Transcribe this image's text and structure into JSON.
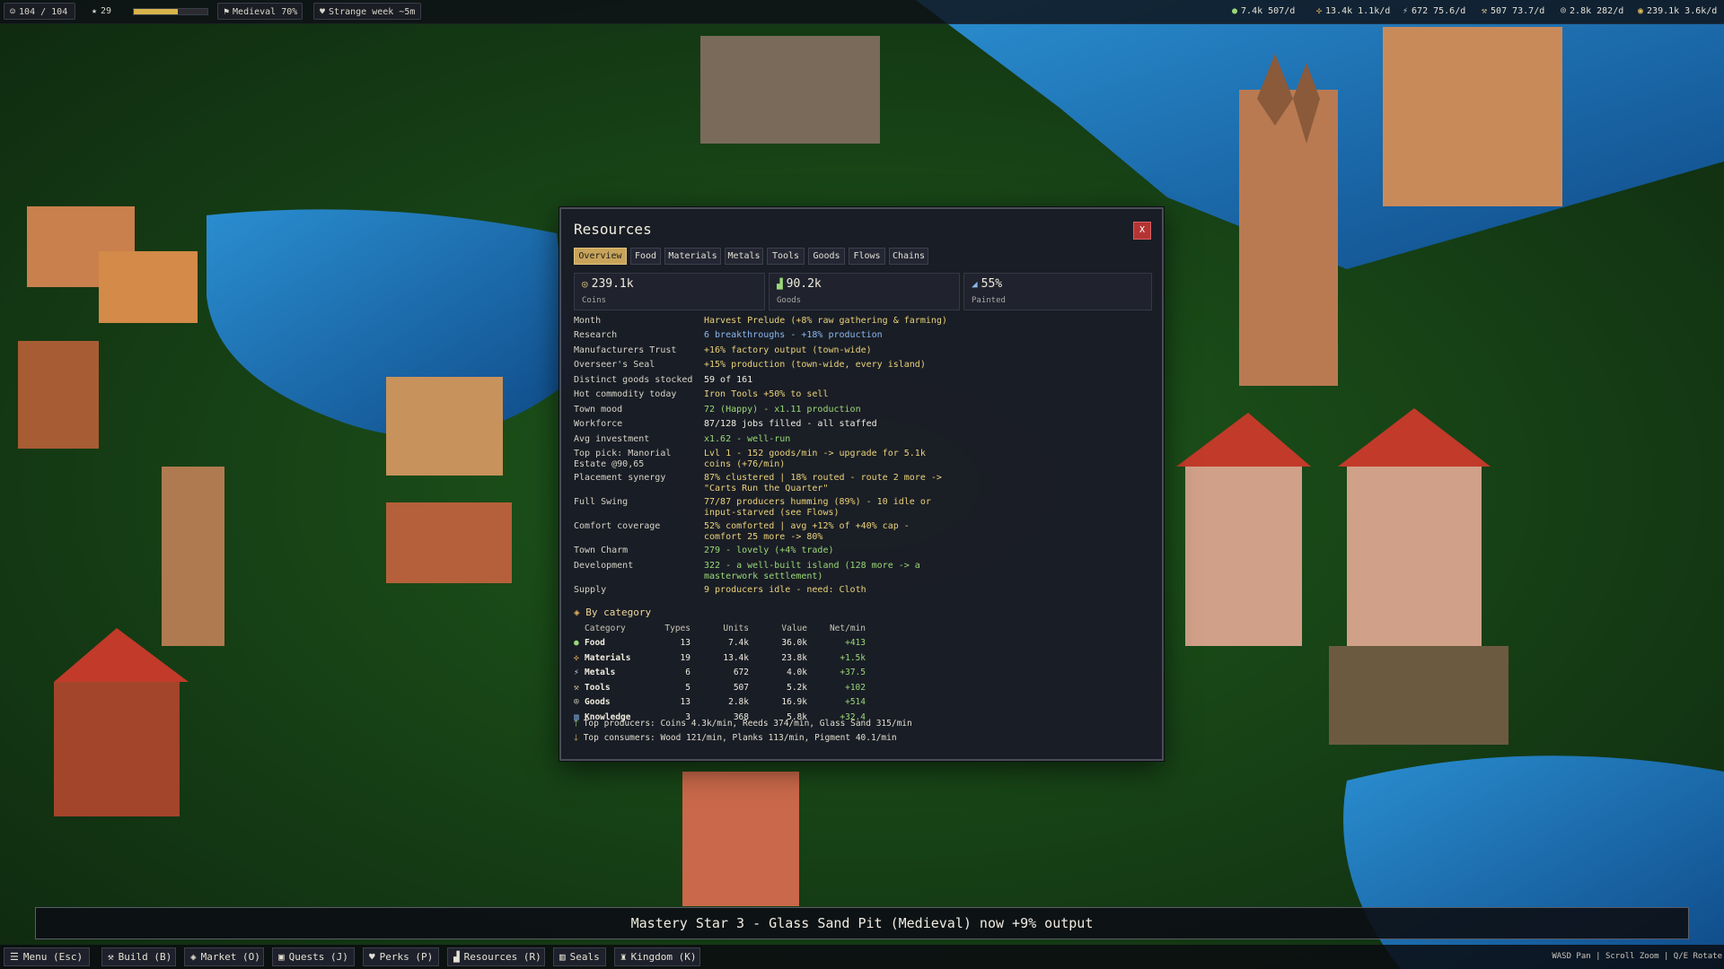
{
  "top_bar": {
    "population": "104 / 104",
    "stars": "29",
    "xp_fraction": 0.6,
    "era": "Medieval 70%",
    "event": "Strange week ~5m",
    "resources": [
      {
        "icon": "food-icon",
        "glyph": "●",
        "color": "#9ad878",
        "text": "7.4k 507/d"
      },
      {
        "icon": "materials-icon",
        "glyph": "✣",
        "color": "#e0b060",
        "text": "13.4k 1.1k/d"
      },
      {
        "icon": "metals-icon",
        "glyph": "⚡",
        "color": "#c8c8d8",
        "text": "672 75.6/d"
      },
      {
        "icon": "tools-icon",
        "glyph": "⚒",
        "color": "#d8c090",
        "text": "507 73.7/d"
      },
      {
        "icon": "goods-icon",
        "glyph": "⌾",
        "color": "#d8d0c0",
        "text": "2.8k 282/d"
      },
      {
        "icon": "coins-icon",
        "glyph": "◉",
        "color": "#e0c060",
        "text": "239.1k 3.6k/d"
      }
    ]
  },
  "window": {
    "title": "Resources",
    "close_label": "X",
    "tabs": [
      "Overview",
      "Food",
      "Materials",
      "Metals",
      "Tools",
      "Goods",
      "Flows",
      "Chains"
    ],
    "active_tab": "Overview",
    "stats": [
      {
        "icon": "coin-icon",
        "glyph": "◎",
        "value": "239.1k",
        "label": "Coins"
      },
      {
        "icon": "goods-chart-icon",
        "glyph": "▟",
        "value": "90.2k",
        "label": "Goods"
      },
      {
        "icon": "paint-icon",
        "glyph": "◢",
        "value": "55%",
        "label": "Painted"
      }
    ],
    "info_rows": [
      {
        "key": "Month",
        "value": "Harvest Prelude (+8% raw gathering & farming)",
        "color": "yellow"
      },
      {
        "key": "Research",
        "value": "6 breakthroughs - +18% production",
        "color": "blue"
      },
      {
        "key": "Manufacturers Trust",
        "value": "+16% factory output (town-wide)",
        "color": "yellow"
      },
      {
        "key": "Overseer's Seal",
        "value": "+15% production (town-wide, every island)",
        "color": "yellow"
      },
      {
        "key": "Distinct goods stocked",
        "value": "59 of 161",
        "color": "white"
      },
      {
        "key": "Hot commodity today",
        "value": "Iron Tools +50% to sell",
        "color": "yellow"
      },
      {
        "key": "Town mood",
        "value": "72 (Happy) - x1.11 production",
        "color": "green"
      },
      {
        "key": "Workforce",
        "value": "87/128 jobs filled - all staffed",
        "color": "white"
      },
      {
        "key": "Avg investment",
        "value": "x1.62 - well-run",
        "color": "green"
      },
      {
        "key": "Top pick: Manorial Estate @90,65",
        "value": "Lvl 1 - 152 goods/min -> upgrade for 5.1k coins (+76/min)",
        "color": "yellow"
      },
      {
        "key": "Placement synergy",
        "value": "87% clustered | 18% routed - route 2 more -> \"Carts Run the Quarter\"",
        "color": "yellow"
      },
      {
        "key": "Full Swing",
        "value": "77/87 producers humming (89%) - 10 idle or input-starved (see Flows)",
        "color": "yellow"
      },
      {
        "key": "Comfort coverage",
        "value": "52% comforted | avg +12% of +40% cap - comfort 25 more -> 80%",
        "color": "yellow"
      },
      {
        "key": "Town Charm",
        "value": "279 - lovely (+4% trade)",
        "color": "green"
      },
      {
        "key": "Development",
        "value": "322 - a well-built island (128 more -> a masterwork settlement)",
        "color": "green"
      },
      {
        "key": "Supply",
        "value": "9 producers idle - need: Cloth",
        "color": "yellow"
      }
    ],
    "by_category": {
      "title": "By category",
      "headers": {
        "category": "Category",
        "types": "Types",
        "units": "Units",
        "value": "Value",
        "net": "Net/min"
      },
      "rows": [
        {
          "icon": "food-icon",
          "glyph": "●",
          "color": "#9ad878",
          "name": "Food",
          "types": "13",
          "units": "7.4k",
          "value": "36.0k",
          "net": "+413"
        },
        {
          "icon": "materials-icon",
          "glyph": "✣",
          "color": "#e0b060",
          "name": "Materials",
          "types": "19",
          "units": "13.4k",
          "value": "23.8k",
          "net": "+1.5k"
        },
        {
          "icon": "metals-icon",
          "glyph": "⚡",
          "color": "#c8c8d8",
          "name": "Metals",
          "types": "6",
          "units": "672",
          "value": "4.0k",
          "net": "+37.5"
        },
        {
          "icon": "tools-icon",
          "glyph": "⚒",
          "color": "#d8c090",
          "name": "Tools",
          "types": "5",
          "units": "507",
          "value": "5.2k",
          "net": "+102"
        },
        {
          "icon": "goods-icon",
          "glyph": "⌾",
          "color": "#d8d0c0",
          "name": "Goods",
          "types": "13",
          "units": "2.8k",
          "value": "16.9k",
          "net": "+514"
        },
        {
          "icon": "knowledge-icon",
          "glyph": "▥",
          "color": "#8ab8f0",
          "name": "Knowledge",
          "types": "3",
          "units": "368",
          "value": "5.8k",
          "net": "+32.4"
        }
      ],
      "top_producers": "Top producers: Coins 4.3k/min, Reeds 374/min, Glass Sand 315/min",
      "top_consumers": "Top consumers: Wood 121/min, Planks 113/min, Pigment 40.1/min"
    }
  },
  "toast": "Mastery Star 3 - Glass Sand Pit (Medieval) now +9% output",
  "bottom_bar": {
    "buttons": [
      {
        "name": "menu-button",
        "icon": "menu-icon",
        "glyph": "☰",
        "label": "Menu (Esc)"
      },
      {
        "name": "build-button",
        "icon": "hammer-icon",
        "glyph": "⚒",
        "label": "Build (B)"
      },
      {
        "name": "market-button",
        "icon": "tag-icon",
        "glyph": "◈",
        "label": "Market (O)"
      },
      {
        "name": "quests-button",
        "icon": "quest-icon",
        "glyph": "▣",
        "label": "Quests (J)"
      },
      {
        "name": "perks-button",
        "icon": "heart-icon",
        "glyph": "♥",
        "label": "Perks (P)"
      },
      {
        "name": "resources-button",
        "icon": "chart-icon",
        "glyph": "▟",
        "label": "Resources (R)"
      },
      {
        "name": "seals-button",
        "icon": "seal-icon",
        "glyph": "▥",
        "label": "Seals"
      },
      {
        "name": "kingdom-button",
        "icon": "castle-icon",
        "glyph": "♜",
        "label": "Kingdom (K)"
      }
    ],
    "controls_hint": "WASD Pan | Scroll Zoom | Q/E Rotate"
  }
}
